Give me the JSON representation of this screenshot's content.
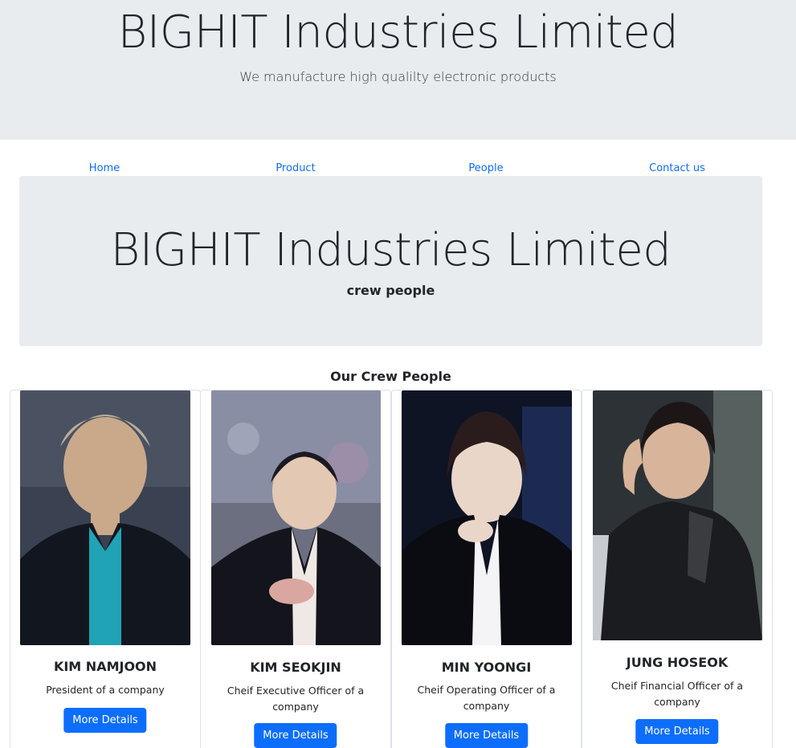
{
  "header": {
    "title": "BIGHIT Industries Limited",
    "tagline": "We manufacture high qualilty electronic products"
  },
  "nav": [
    "Home",
    "Product",
    "People",
    "Contact us"
  ],
  "jumbotron": {
    "title": "BIGHIT Industries Limited",
    "subtitle": "crew people"
  },
  "section_title": "Our Crew People",
  "people": [
    {
      "name": "KIM NAMJOON",
      "role": "President of a company",
      "button": "More Details"
    },
    {
      "name": "KIM SEOKJIN",
      "role": "Cheif Executive Officer of a company",
      "button": "More Details"
    },
    {
      "name": "MIN YOONGI",
      "role": "Cheif Operating Officer of a company",
      "button": "More Details"
    },
    {
      "name": "JUNG HOSEOK",
      "role": "Cheif Financial Officer of a company",
      "button": "More Details"
    }
  ],
  "colors": {
    "accent": "#0d6efd",
    "panel": "#e9ecef"
  }
}
